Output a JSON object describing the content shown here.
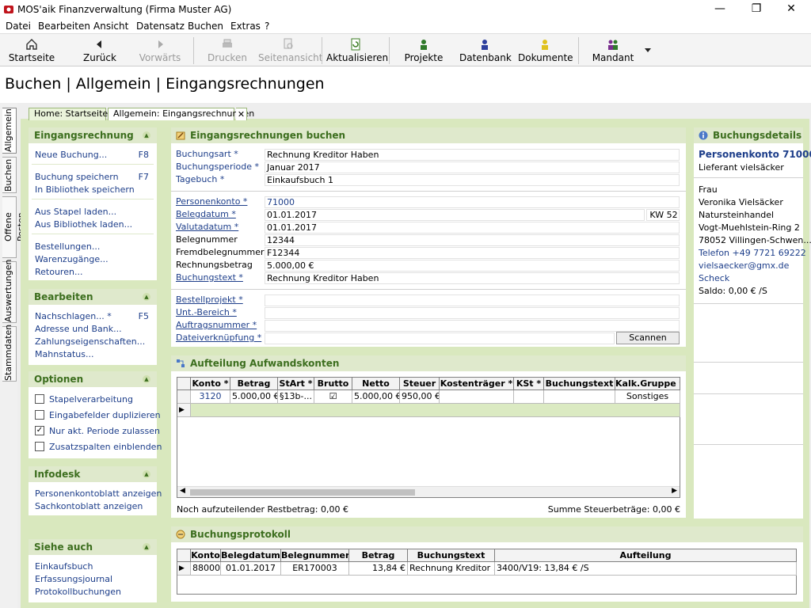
{
  "window": {
    "title": "MOS'aik Finanzverwaltung (Firma Muster AG)",
    "minimize_glyph": "—",
    "maximize_glyph": "❐",
    "close_glyph": "✕"
  },
  "menu": [
    "Datei",
    "Bearbeiten",
    "Ansicht",
    "Datensatz",
    "Buchen",
    "Extras",
    "?"
  ],
  "toolbar": {
    "startseite": "Startseite",
    "zurueck": "Zurück",
    "vorwaerts": "Vorwärts",
    "drucken": "Drucken",
    "seitenansicht": "Seitenansicht",
    "aktualisieren": "Aktualisieren",
    "projekte": "Projekte",
    "datenbank": "Datenbank",
    "dokumente": "Dokumente",
    "mandant": "Mandant"
  },
  "page_title": "Buchen | Allgemein | Eingangsrechnungen",
  "side_tabs": [
    "Allgemein",
    "Buchen",
    "Offene Posten",
    "Auswertungen",
    "Stammdaten"
  ],
  "doc_tabs": [
    "Home: Startseite",
    "Allgemein: Eingangsrechnungen"
  ],
  "left": {
    "eingangsrechnung": {
      "title": "Eingangsrechnung",
      "neue_buchung": "Neue Buchung...",
      "neue_buchung_key": "F8",
      "buchung_speichern": "Buchung speichern",
      "buchung_speichern_key": "F7",
      "in_bibliothek": "In Bibliothek speichern",
      "aus_stapel": "Aus Stapel laden...",
      "aus_bibliothek": "Aus Bibliothek laden...",
      "bestellungen": "Bestellungen...",
      "warenzugaenge": "Warenzugänge...",
      "retouren": "Retouren..."
    },
    "bearbeiten": {
      "title": "Bearbeiten",
      "nachschlagen": "Nachschlagen... *",
      "nachschlagen_key": "F5",
      "adresse": "Adresse und Bank...",
      "zahlung": "Zahlungseigenschaften...",
      "mahnstatus": "Mahnstatus..."
    },
    "optionen": {
      "title": "Optionen",
      "items": [
        {
          "label": "Stapelverarbeitung",
          "checked": ""
        },
        {
          "label": "Eingabefelder duplizieren",
          "checked": ""
        },
        {
          "label": "Nur akt. Periode zulassen",
          "checked": "✓"
        },
        {
          "label": "Zusatzspalten einblenden",
          "checked": ""
        }
      ]
    },
    "infodesk": {
      "title": "Infodesk",
      "personenkonto": "Personenkontoblatt anzeigen",
      "sachkonto": "Sachkontoblatt anzeigen"
    },
    "siehe_auch": {
      "title": "Siehe auch",
      "einkaufsbuch": "Einkaufsbuch",
      "erfassungsjournal": "Erfassungsjournal",
      "protokoll": "Protokollbuchungen"
    }
  },
  "form": {
    "title": "Eingangsrechnungen buchen",
    "buchungsart_label": "Buchungsart *",
    "buchungsart": "Rechnung Kreditor Haben",
    "buchungsperiode_label": "Buchungsperiode *",
    "buchungsperiode": "Januar 2017",
    "tagebuch_label": "Tagebuch *",
    "tagebuch": "Einkaufsbuch 1",
    "personenkonto_label": "Personenkonto *",
    "personenkonto": "71000",
    "belegdatum_label": "Belegdatum *",
    "belegdatum": "01.01.2017",
    "kw": "KW 52",
    "valutadatum_label": "Valutadatum *",
    "valutadatum": "01.01.2017",
    "belegnummer_label": "Belegnummer",
    "belegnummer": "12344",
    "fremdbeleg_label": "Fremdbelegnummer",
    "fremdbeleg": "F12344",
    "rechnungsbetrag_label": "Rechnungsbetrag",
    "rechnungsbetrag": "5.000,00 €",
    "buchungstext_label": "Buchungstext *",
    "buchungstext": "Rechnung Kreditor Haben",
    "bestellprojekt_label": "Bestellprojekt *",
    "unt_bereich_label": "Unt.-Bereich *",
    "auftragsnummer_label": "Auftragsnummer *",
    "dateiverknuepfung_label": "Dateiverknüpfung *",
    "scannen": "Scannen"
  },
  "aufteilung": {
    "title": "Aufteilung Aufwandskonten",
    "columns": [
      "Konto *",
      "Betrag",
      "StArt *",
      "Brutto",
      "Netto",
      "Steuer",
      "Kostenträger *",
      "KSt *",
      "Buchungstext",
      "Kalk.Gruppe *"
    ],
    "row": {
      "konto": "3120",
      "betrag": "5.000,00 €",
      "start": "§13b-...",
      "brutto": "☑",
      "netto": "5.000,00 €",
      "steuer": "950,00 €",
      "kostentraeger": "",
      "kst": "",
      "buchungstext": "",
      "kalk": "Sonstiges"
    },
    "restbetrag": "Noch aufzuteilender Restbetrag: 0,00 €",
    "summe_steuer": "Summe Steuerbeträge: 0,00 €"
  },
  "protokoll": {
    "title": "Buchungsprotokoll",
    "columns": [
      "Konto",
      "Belegdatum",
      "Belegnummer",
      "Betrag",
      "Buchungstext",
      "Aufteilung"
    ],
    "row": {
      "konto": "88000",
      "belegdatum": "01.01.2017",
      "belegnummer": "ER170003",
      "betrag": "13,84 €",
      "buchungstext": "Rechnung Kreditor ...",
      "aufteilung": "3400/V19: 13,84 € /S"
    }
  },
  "details": {
    "title": "Buchungsdetails",
    "konto": "Personenkonto 71000",
    "lieferant": "Lieferant vielsäcker",
    "anrede": "Frau",
    "name": "Veronika Vielsäcker",
    "firma": "Natursteinhandel",
    "strasse": "Vogt-Muehlstein-Ring 2",
    "ort": "78052 Villingen-Schwen...",
    "telefon": "Telefon +49 7721 69222",
    "email": "vielsaecker@gmx.de",
    "scheck": "Scheck",
    "saldo": "Saldo: 0,00 € /S"
  },
  "colors": {
    "accent_green": "#3c6e1e",
    "link_blue": "#1d3e8a",
    "panel_head": "#dfe9cc",
    "work_bg": "#d9e8be"
  }
}
